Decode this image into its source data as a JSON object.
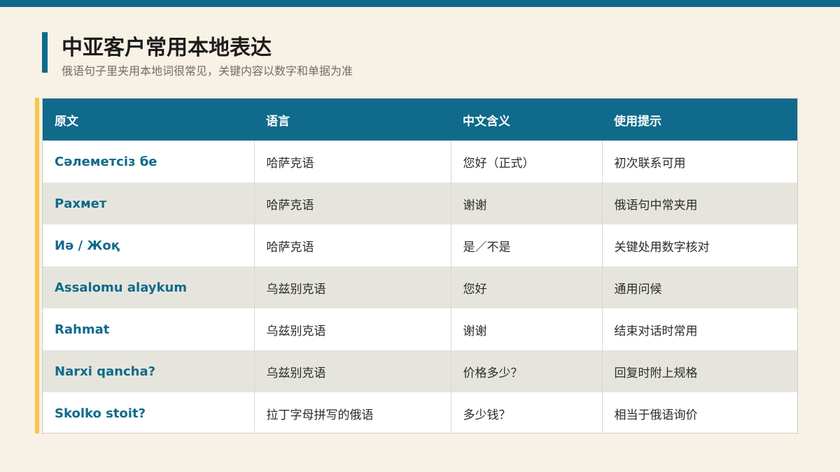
{
  "header": {
    "title": "中亚客户常用本地表达",
    "subtitle": "俄语句子里夹用本地词很常见，关键内容以数字和单据为准"
  },
  "colors": {
    "primary": "#0f6a8b",
    "accent": "#f6c54c",
    "background": "#f8f1e5"
  },
  "table": {
    "headers": [
      "原文",
      "语言",
      "中文含义",
      "使用提示"
    ],
    "rows": [
      {
        "original": "Сәлеметсіз бе",
        "language": "哈萨克语",
        "meaning": "您好（正式）",
        "tip": "初次联系可用"
      },
      {
        "original": "Рахмет",
        "language": "哈萨克语",
        "meaning": "谢谢",
        "tip": "俄语句中常夹用"
      },
      {
        "original": "Иә / Жоқ",
        "language": "哈萨克语",
        "meaning": "是／不是",
        "tip": "关键处用数字核对"
      },
      {
        "original": "Assalomu alaykum",
        "language": "乌兹别克语",
        "meaning": "您好",
        "tip": "通用问候"
      },
      {
        "original": "Rahmat",
        "language": "乌兹别克语",
        "meaning": "谢谢",
        "tip": "结束对话时常用"
      },
      {
        "original": "Narxi qancha?",
        "language": "乌兹别克语",
        "meaning": "价格多少？",
        "tip": "回复时附上规格"
      },
      {
        "original": "Skolko stoit?",
        "language": "拉丁字母拼写的俄语",
        "meaning": "多少钱？",
        "tip": "相当于俄语询价"
      }
    ]
  }
}
